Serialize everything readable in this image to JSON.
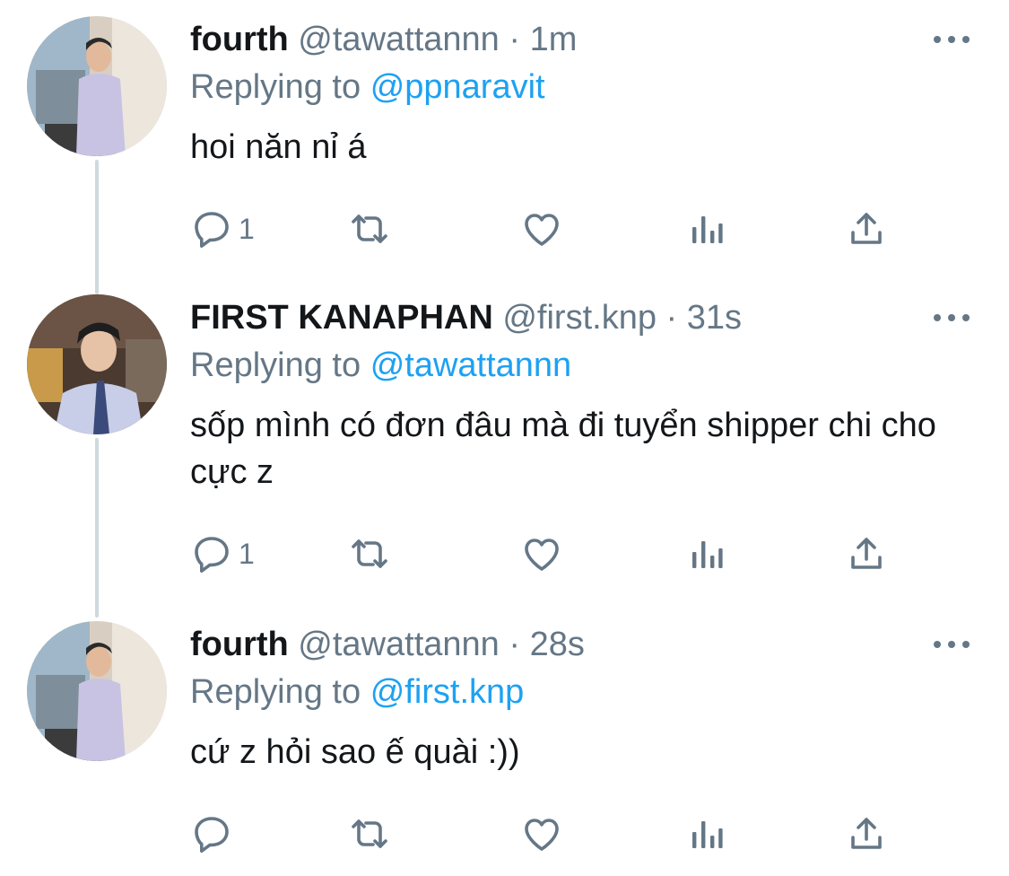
{
  "tweets": [
    {
      "name": "fourth",
      "handle": "@tawattannn",
      "time": "1m",
      "reply_prefix": "Replying to",
      "reply_to": "@ppnaravit",
      "text": "hoi năn nỉ á",
      "reply_count": "1"
    },
    {
      "name": "FIRST KANAPHAN",
      "handle": "@first.knp",
      "time": "31s",
      "reply_prefix": "Replying to",
      "reply_to": "@tawattannn",
      "text": "sốp mình có đơn đâu mà đi tuyển shipper chi cho cực z",
      "reply_count": "1"
    },
    {
      "name": "fourth",
      "handle": "@tawattannn",
      "time": "28s",
      "reply_prefix": "Replying to",
      "reply_to": "@first.knp",
      "text": "cứ z hỏi sao ế quài :))",
      "reply_count": ""
    }
  ],
  "separator": "·",
  "icons": [
    "reply-icon",
    "retweet-icon",
    "like-icon",
    "analytics-icon",
    "share-icon",
    "more-icon"
  ],
  "colors": {
    "text": "#14171a",
    "secondary": "#657786",
    "link": "#1da1f2",
    "thread_line": "#cfd9de"
  }
}
